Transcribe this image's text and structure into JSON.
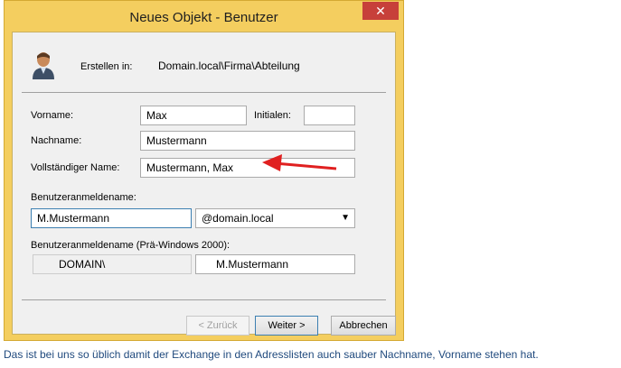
{
  "window": {
    "title": "Neues Objekt - Benutzer",
    "close_glyph": "✕"
  },
  "header": {
    "create_in_label": "Erstellen in:",
    "create_in_path": "Domain.local\\Firma\\Abteilung",
    "icon": "user-icon"
  },
  "form": {
    "vorname_label": "Vorname:",
    "vorname_value": "Max",
    "initialen_label": "Initialen:",
    "initialen_value": "",
    "nachname_label": "Nachname:",
    "nachname_value": "Mustermann",
    "fullname_label": "Vollständiger Name:",
    "fullname_value": "Mustermann, Max",
    "logon_label": "Benutzeranmeldename:",
    "logon_value": "M.Mustermann",
    "domain_suffix": "@domain.local",
    "pre2000_label": "Benutzeranmeldename (Prä-Windows 2000):",
    "pre2000_domain": "DOMAIN\\",
    "pre2000_value": "M.Mustermann"
  },
  "buttons": {
    "back": "< Zurück",
    "next": "Weiter >",
    "cancel": "Abbrechen"
  },
  "annotation": {
    "arrow_color": "#e02020"
  },
  "caption": "Das ist bei uns so üblich damit der Exchange in den Adresslisten auch sauber Nachname, Vorname stehen hat."
}
